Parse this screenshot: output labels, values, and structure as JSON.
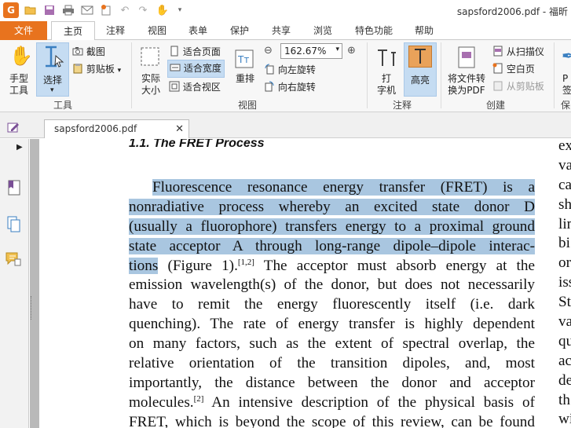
{
  "window": {
    "title": "sapsford2006.pdf - 福昕"
  },
  "quick_access": [
    "app-logo",
    "open-icon",
    "save-icon",
    "print-icon",
    "email-icon",
    "new-icon",
    "undo-icon",
    "redo-icon",
    "hand-icon",
    "customize-icon"
  ],
  "ribbon_tabs": [
    "文件",
    "主页",
    "注释",
    "视图",
    "表单",
    "保护",
    "共享",
    "浏览",
    "特色功能",
    "帮助"
  ],
  "ribbon": {
    "hand_tool": "手型\n工具",
    "select_tool": "选择",
    "screenshot": "截图",
    "clipboard": "剪贴板",
    "tools_group": "工具",
    "actual_size": "实际\n大小",
    "fit_page": "适合页面",
    "fit_width": "适合宽度",
    "fit_visible": "适合视区",
    "reflow": "重排",
    "zoom_value": "162.67%",
    "rotate_left": "向左旋转",
    "rotate_right": "向右旋转",
    "view_group": "视图",
    "typewriter": "打\n字机",
    "highlight": "高亮",
    "comment_group": "注释",
    "to_pdf": "将文件转\n换为PDF",
    "from_scanner": "从扫描仪",
    "blank_page": "空白页",
    "from_clipboard": "从剪贴板",
    "create_group": "创建",
    "protect_group": "保",
    "sign_partial": "P\n签"
  },
  "document": {
    "tab_name": "sapsford2006.pdf",
    "section_heading": "1.1. The FRET Process",
    "lines": [
      {
        "hl": "Fluorescence resonance energy transfer (FRET) is a",
        "rest": "",
        "indent": true
      },
      {
        "hl": "nonradiative process whereby an excited state donor D",
        "rest": ""
      },
      {
        "hl": "(usually a fluorophore) transfers energy to a proximal ground",
        "rest": ""
      },
      {
        "hl": "state acceptor A through long-range dipole–dipole interac-",
        "rest": ""
      },
      {
        "hl": "tions",
        "rest": " (Figure 1).",
        "sup": "[1,2]",
        "rest2": " The acceptor must absorb energy at the"
      },
      {
        "hl": "",
        "rest": "emission wavelength(s) of the donor, but does not necessarily"
      },
      {
        "hl": "",
        "rest": "have to remit the energy fluorescently itself (i.e. dark"
      },
      {
        "hl": "",
        "rest": "quenching). The rate of energy transfer is highly dependent"
      },
      {
        "hl": "",
        "rest": "on many factors, such as the extent of spectral overlap, the"
      },
      {
        "hl": "",
        "rest": "relative orientation of the transition dipoles, and, most"
      },
      {
        "hl": "",
        "rest": "importantly, the distance between the donor and acceptor"
      },
      {
        "hl": "",
        "rest": "molecules.",
        "sup": "[2]",
        "rest2": " An intensive description of the physical basis of"
      },
      {
        "hl": "",
        "rest": "FRET, which is beyond the scope of this review, can be found"
      }
    ],
    "right_column": [
      "ex",
      "va",
      "ca",
      "sh",
      "lin",
      "bi",
      "or",
      "iss",
      "St",
      "va",
      "qu",
      "ac",
      "de",
      "th",
      "wi"
    ]
  }
}
